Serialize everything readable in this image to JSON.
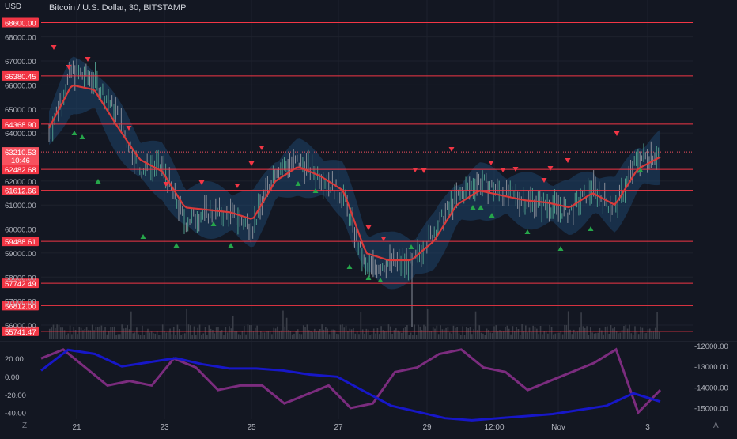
{
  "header": {
    "title": "Bitcoin / U.S. Dollar, 30, BITSTAMP",
    "currency": "USD"
  },
  "price_axis": {
    "ticks": [
      "68000.00",
      "67000.00",
      "66000.00",
      "65000.00",
      "64000.00",
      "63000.00",
      "62000.00",
      "61000.00",
      "60000.00",
      "59000.00",
      "58000.00",
      "57000.00",
      "56000.00"
    ],
    "tick_values": [
      68000,
      67000,
      66000,
      65000,
      64000,
      63000,
      62000,
      61000,
      60000,
      59000,
      58000,
      57000,
      56000
    ]
  },
  "levels": [
    {
      "label": "68600.00",
      "value": 68600
    },
    {
      "label": "66380.45",
      "value": 66380.45
    },
    {
      "label": "64368.90",
      "value": 64368.9
    },
    {
      "label": "62482.68",
      "value": 62482.68
    },
    {
      "label": "61612.66",
      "value": 61612.66
    },
    {
      "label": "59488.61",
      "value": 59488.61
    },
    {
      "label": "57742.49",
      "value": 57742.49
    },
    {
      "label": "56812.00",
      "value": 56812
    },
    {
      "label": "55741.47",
      "value": 55741.47
    }
  ],
  "current_price": {
    "label": "63210.53",
    "countdown": "10:46",
    "value": 63210.53
  },
  "time_axis": {
    "labels": [
      "21",
      "23",
      "25",
      "27",
      "29",
      "12:00",
      "Nov",
      "3"
    ]
  },
  "oscillator": {
    "left_ticks": [
      "20.00",
      "0.00",
      "-20.00",
      "-40.00"
    ],
    "left_values": [
      20,
      0,
      -20,
      -40
    ],
    "right_ticks": [
      "-12000.00",
      "-13000.00",
      "-14000.00",
      "-15000.00"
    ],
    "right_values": [
      -12000,
      -13000,
      -14000,
      -15000
    ]
  },
  "corner": {
    "left": "Z",
    "right": "A"
  },
  "colors": {
    "background": "#131722",
    "level_line": "#f23645",
    "ma": "#d93a3a",
    "band": "#1f4e79",
    "sell_marker": "#f23645",
    "buy_marker": "#26a64a",
    "oscillator_purple": "#7b2c7e",
    "oscillator_blue": "#1717c8"
  },
  "chart_data": {
    "type": "line",
    "x": [
      "Oct 20 12:00",
      "Oct 21 00:00",
      "Oct 21 12:00",
      "Oct 22 00:00",
      "Oct 22 12:00",
      "Oct 23 00:00",
      "Oct 23 12:00",
      "Oct 24 00:00",
      "Oct 24 12:00",
      "Oct 25 00:00",
      "Oct 25 12:00",
      "Oct 26 00:00",
      "Oct 26 12:00",
      "Oct 27 00:00",
      "Oct 27 12:00",
      "Oct 28 00:00",
      "Oct 28 12:00",
      "Oct 29 00:00",
      "Oct 29 12:00",
      "Oct 30 00:00",
      "Oct 30 12:00",
      "Oct 31 00:00",
      "Oct 31 12:00",
      "Nov 1 00:00",
      "Nov 1 12:00",
      "Nov 2 00:00",
      "Nov 2 12:00",
      "Nov 3 00:00"
    ],
    "series": [
      {
        "values": [
          64000,
          66600,
          66200,
          64800,
          62500,
          62600,
          60300,
          60700,
          60600,
          60100,
          62500,
          62800,
          62200,
          61400,
          58300,
          58600,
          58500,
          59900,
          61300,
          62000,
          61500,
          61200,
          61000,
          60700,
          61700,
          60800,
          62900,
          63200
        ]
      },
      {
        "values": [
          64200,
          66000,
          65800,
          64300,
          62900,
          62400,
          60900,
          60800,
          60700,
          60400,
          62000,
          62600,
          62200,
          61600,
          59000,
          58700,
          58700,
          59500,
          61000,
          61600,
          61400,
          61200,
          61100,
          60900,
          61500,
          61000,
          62500,
          63000
        ]
      }
    ],
    "oscillator_series": [
      {
        "values": [
          20,
          30,
          10,
          -10,
          -5,
          -10,
          20,
          10,
          -15,
          -10,
          -10,
          -30,
          -20,
          -10,
          -35,
          -30,
          5,
          10,
          25,
          30,
          10,
          5,
          -15,
          -5,
          5,
          15,
          30,
          -40,
          -15
        ]
      },
      {
        "values": [
          -13200,
          -12200,
          -12400,
          -13000,
          -12800,
          -12600,
          -12900,
          -13100,
          -13100,
          -13200,
          -13400,
          -13500,
          -14200,
          -14900,
          -15200,
          -15500,
          -15600,
          -15500,
          -15400,
          -15300,
          -15100,
          -14900,
          -14300,
          -14700
        ]
      }
    ],
    "ylim": [
      55600,
      69000
    ]
  }
}
